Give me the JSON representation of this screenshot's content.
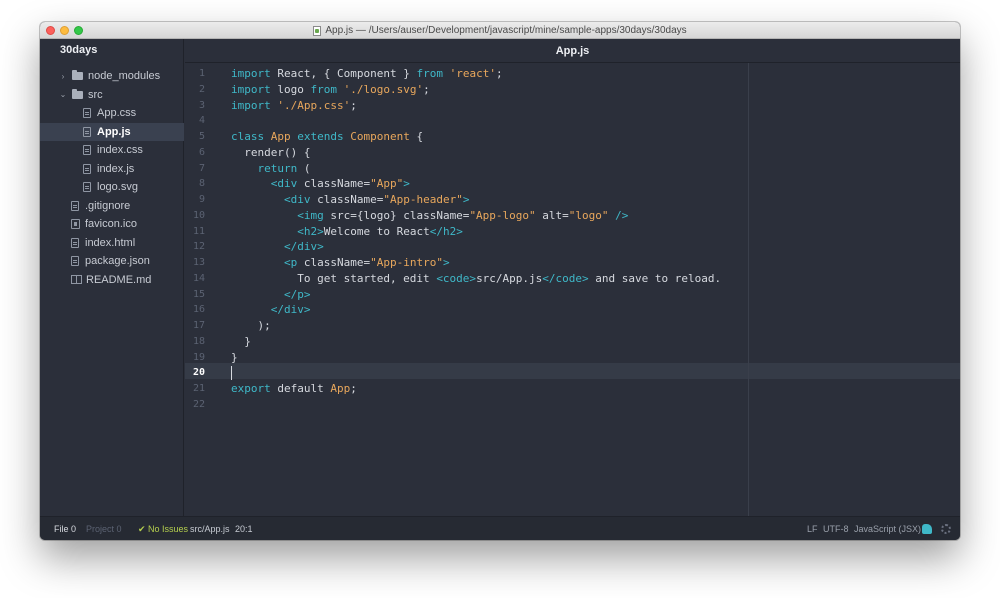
{
  "window": {
    "title": "App.js — /Users/auser/Development/javascript/mine/sample-apps/30days/30days"
  },
  "sidebar": {
    "project_name": "30days",
    "items": [
      {
        "label": "node_modules",
        "kind": "folder",
        "expanded": false,
        "depth": 0,
        "chevron": "›"
      },
      {
        "label": "src",
        "kind": "folder",
        "expanded": true,
        "depth": 0,
        "chevron": "⌄"
      },
      {
        "label": "App.css",
        "kind": "file",
        "depth": 1
      },
      {
        "label": "App.js",
        "kind": "file",
        "depth": 1,
        "selected": true
      },
      {
        "label": "index.css",
        "kind": "file",
        "depth": 1
      },
      {
        "label": "index.js",
        "kind": "file",
        "depth": 1
      },
      {
        "label": "logo.svg",
        "kind": "file",
        "depth": 1
      },
      {
        "label": ".gitignore",
        "kind": "file",
        "depth": 0
      },
      {
        "label": "favicon.ico",
        "kind": "media",
        "depth": 0
      },
      {
        "label": "index.html",
        "kind": "file",
        "depth": 0
      },
      {
        "label": "package.json",
        "kind": "file",
        "depth": 0
      },
      {
        "label": "README.md",
        "kind": "book",
        "depth": 0
      }
    ]
  },
  "editor": {
    "tab_title": "App.js",
    "cursor_line": 20,
    "lines": [
      {
        "num": "1",
        "tokens": [
          [
            "kw",
            "import"
          ],
          [
            "txt",
            " React, { Component } "
          ],
          [
            "kw",
            "from"
          ],
          [
            "txt",
            " "
          ],
          [
            "str",
            "'react'"
          ],
          [
            "txt",
            ";"
          ]
        ]
      },
      {
        "num": "2",
        "tokens": [
          [
            "kw",
            "import"
          ],
          [
            "txt",
            " logo "
          ],
          [
            "kw",
            "from"
          ],
          [
            "txt",
            " "
          ],
          [
            "str",
            "'./logo.svg'"
          ],
          [
            "txt",
            ";"
          ]
        ]
      },
      {
        "num": "3",
        "tokens": [
          [
            "kw",
            "import"
          ],
          [
            "txt",
            " "
          ],
          [
            "str",
            "'./App.css'"
          ],
          [
            "txt",
            ";"
          ]
        ]
      },
      {
        "num": "4",
        "tokens": []
      },
      {
        "num": "5",
        "tokens": [
          [
            "kw",
            "class"
          ],
          [
            "txt",
            " "
          ],
          [
            "cls",
            "App"
          ],
          [
            "txt",
            " "
          ],
          [
            "kw",
            "extends"
          ],
          [
            "txt",
            " "
          ],
          [
            "cls",
            "Component"
          ],
          [
            "txt",
            " {"
          ]
        ]
      },
      {
        "num": "6",
        "tokens": [
          [
            "txt",
            "  render() {"
          ]
        ]
      },
      {
        "num": "7",
        "tokens": [
          [
            "txt",
            "    "
          ],
          [
            "kw",
            "return"
          ],
          [
            "txt",
            " ("
          ]
        ]
      },
      {
        "num": "8",
        "tokens": [
          [
            "txt",
            "      "
          ],
          [
            "tag",
            "<div"
          ],
          [
            "txt",
            " className="
          ],
          [
            "str",
            "\"App\""
          ],
          [
            "tag",
            ">"
          ]
        ]
      },
      {
        "num": "9",
        "tokens": [
          [
            "txt",
            "        "
          ],
          [
            "tag",
            "<div"
          ],
          [
            "txt",
            " className="
          ],
          [
            "str",
            "\"App-header\""
          ],
          [
            "tag",
            ">"
          ]
        ]
      },
      {
        "num": "10",
        "tokens": [
          [
            "txt",
            "          "
          ],
          [
            "tag",
            "<img"
          ],
          [
            "txt",
            " src={logo} className="
          ],
          [
            "str",
            "\"App-logo\""
          ],
          [
            "txt",
            " alt="
          ],
          [
            "str",
            "\"logo\""
          ],
          [
            "txt",
            " "
          ],
          [
            "tag",
            "/>"
          ]
        ]
      },
      {
        "num": "11",
        "tokens": [
          [
            "txt",
            "          "
          ],
          [
            "tag",
            "<h2>"
          ],
          [
            "txt",
            "Welcome to React"
          ],
          [
            "tag",
            "</h2>"
          ]
        ]
      },
      {
        "num": "12",
        "tokens": [
          [
            "txt",
            "        "
          ],
          [
            "tag",
            "</div>"
          ]
        ]
      },
      {
        "num": "13",
        "tokens": [
          [
            "txt",
            "        "
          ],
          [
            "tag",
            "<p"
          ],
          [
            "txt",
            " className="
          ],
          [
            "str",
            "\"App-intro\""
          ],
          [
            "tag",
            ">"
          ]
        ]
      },
      {
        "num": "14",
        "tokens": [
          [
            "txt",
            "          To get started, edit "
          ],
          [
            "tag",
            "<code>"
          ],
          [
            "txt",
            "src/App.js"
          ],
          [
            "tag",
            "</code>"
          ],
          [
            "txt",
            " and save to reload."
          ]
        ]
      },
      {
        "num": "15",
        "tokens": [
          [
            "txt",
            "        "
          ],
          [
            "tag",
            "</p>"
          ]
        ]
      },
      {
        "num": "16",
        "tokens": [
          [
            "txt",
            "      "
          ],
          [
            "tag",
            "</div>"
          ]
        ]
      },
      {
        "num": "17",
        "tokens": [
          [
            "txt",
            "    );"
          ]
        ]
      },
      {
        "num": "18",
        "tokens": [
          [
            "txt",
            "  }"
          ]
        ]
      },
      {
        "num": "19",
        "tokens": [
          [
            "txt",
            "}"
          ]
        ]
      },
      {
        "num": "20",
        "tokens": []
      },
      {
        "num": "21",
        "tokens": [
          [
            "kw",
            "export"
          ],
          [
            "txt",
            " default "
          ],
          [
            "cls",
            "App"
          ],
          [
            "txt",
            ";"
          ]
        ]
      },
      {
        "num": "22",
        "tokens": []
      }
    ]
  },
  "statusbar": {
    "file_count": "File 0",
    "project_count": "Project 0",
    "issues": "✔ No Issues",
    "file_path": "src/App.js",
    "cursor_position": "20:1",
    "line_ending": "LF",
    "encoding": "UTF-8",
    "grammar": "JavaScript (JSX)"
  },
  "colors": {
    "background": "#2b2f3a",
    "keyword": "#3fb8c8",
    "string": "#e8a75c",
    "text": "#d6d9df",
    "gutter": "#5b6272",
    "issues_ok": "#b5cf4e"
  }
}
